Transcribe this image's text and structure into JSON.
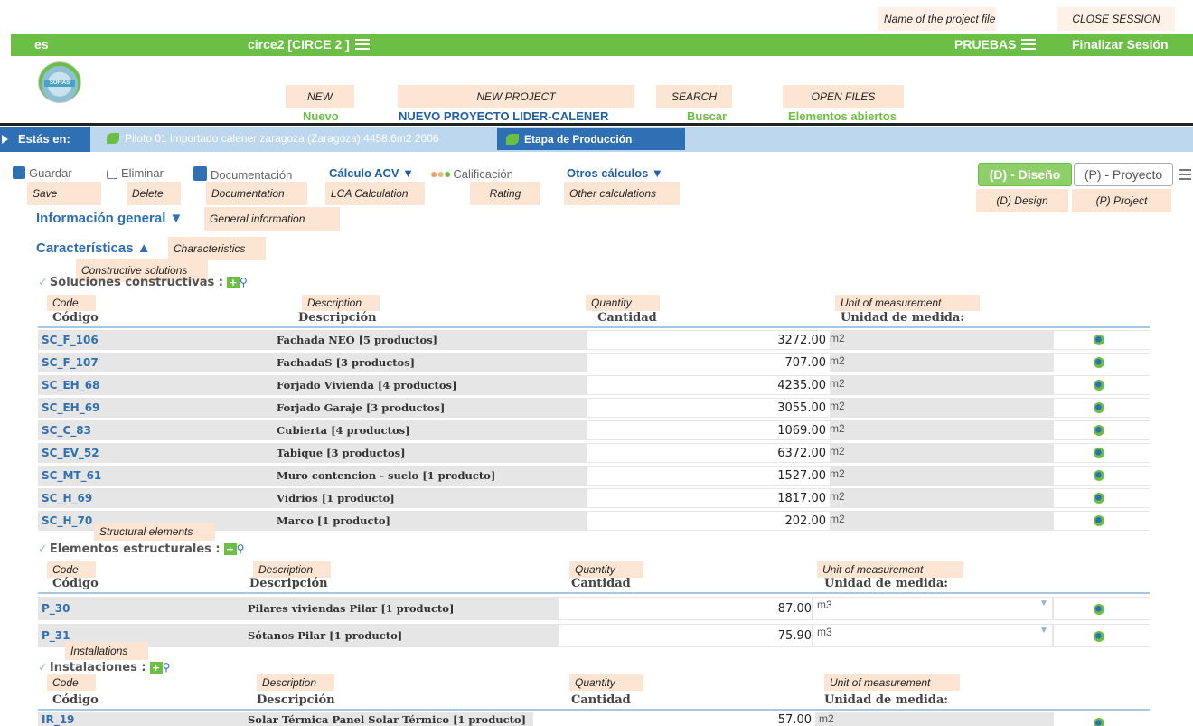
{
  "annotations": {
    "project_file": "Name of the project file",
    "close_session": "CLOSE SESSION",
    "new": "NEW",
    "new_project": "NEW PROJECT",
    "search": "SEARCH",
    "open_files": "OPEN FILES",
    "save": "Save",
    "delete": "Delete",
    "documentation": "Documentation",
    "lca": "LCA Calculation",
    "rating": "Rating",
    "other": "Other calculations",
    "design": "(D) Design",
    "project": "(P) Project",
    "general_info": "General information",
    "characteristics": "Characteristics",
    "constructive": "Constructive solutions",
    "structural": "Structural elements",
    "installations": "Installations",
    "code": "Code",
    "description": "Description",
    "quantity": "Quantity",
    "unit": "Unit of measurement"
  },
  "topbar": {
    "lang": "es",
    "project": "circe2 [CIRCE 2 ]",
    "file": "PRUEBAS",
    "logout": "Finalizar Sesión"
  },
  "logo": {
    "text": "SOFIAS"
  },
  "nav": {
    "new": "Nuevo",
    "new_project": "NUEVO PROYECTO LIDER-CALENER",
    "search": "Buscar",
    "open": "Elementos abiertos"
  },
  "breadcrumb": {
    "label": "Estás en:",
    "item": "Piloto 01 importado calener zaragoza (Zaragoza) 4458.6m2 2006",
    "active": "Etapa de Producción"
  },
  "toolbar": {
    "save": "Guardar",
    "delete": "Eliminar",
    "documentation": "Documentación",
    "lca": "Cálculo ACV ▼",
    "rating": "Calificación",
    "other": "Otros cálculos ▼",
    "design": "(D) - Diseño",
    "project": "(P) - Proyecto"
  },
  "sections": {
    "general": "Información general ▼",
    "characteristics": "Características ▲"
  },
  "headers": {
    "code": "Código",
    "description": "Descripción",
    "quantity": "Cantidad",
    "unit": "Unidad de medida:"
  },
  "constructive": {
    "title": "Soluciones constructivas :",
    "rows": [
      {
        "code": "SC_F_106",
        "desc": "Fachada NEO [5 productos]",
        "qty": "3272.00",
        "unit": "m2"
      },
      {
        "code": "SC_F_107",
        "desc": "FachadaS [3 productos]",
        "qty": "707.00",
        "unit": "m2"
      },
      {
        "code": "SC_EH_68",
        "desc": "Forjado Vivienda [4 productos]",
        "qty": "4235.00",
        "unit": "m2"
      },
      {
        "code": "SC_EH_69",
        "desc": "Forjado Garaje [3 productos]",
        "qty": "3055.00",
        "unit": "m2"
      },
      {
        "code": "SC_C_83",
        "desc": "Cubierta [4 productos]",
        "qty": "1069.00",
        "unit": "m2"
      },
      {
        "code": "SC_EV_52",
        "desc": "Tabique [3 productos]",
        "qty": "6372.00",
        "unit": "m2"
      },
      {
        "code": "SC_MT_61",
        "desc": "Muro contencion - suelo [1 producto]",
        "qty": "1527.00",
        "unit": "m2"
      },
      {
        "code": "SC_H_69",
        "desc": "Vidrios [1 producto]",
        "qty": "1817.00",
        "unit": "m2"
      },
      {
        "code": "SC_H_70",
        "desc": "Marco [1 producto]",
        "qty": "202.00",
        "unit": "m2"
      }
    ]
  },
  "structural": {
    "title": "Elementos estructurales :",
    "rows": [
      {
        "code": "P_30",
        "desc": "Pilares viviendas Pilar [1 producto]",
        "qty": "87.00",
        "unit": "m3"
      },
      {
        "code": "P_31",
        "desc": "Sótanos Pilar [1 producto]",
        "qty": "75.90",
        "unit": "m3"
      }
    ]
  },
  "installations": {
    "title": "Instalaciones :",
    "rows": [
      {
        "code": "IR_19",
        "desc": "Solar Térmica Panel Solar Térmico [1 producto]",
        "qty": "57.00",
        "unit": "m2"
      }
    ]
  },
  "colors": {
    "green": "#6cbf45",
    "blue": "#2f6fb3",
    "annotation_bg": "#fde5d3"
  }
}
